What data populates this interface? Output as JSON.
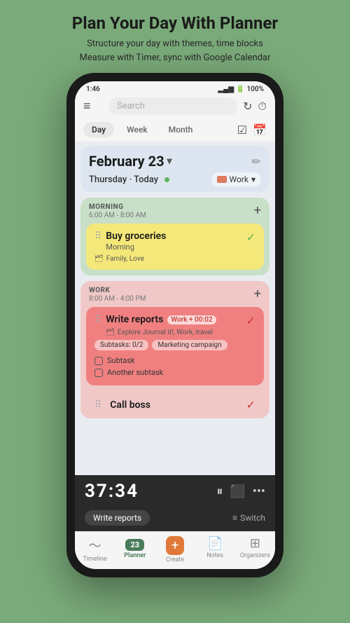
{
  "header": {
    "title": "Plan Your Day With Planner",
    "subtitle_line1": "Structure your day with themes, time blocks",
    "subtitle_line2": "Measure with Timer, sync with Google Calendar"
  },
  "status_bar": {
    "time": "1:46",
    "battery": "100%"
  },
  "search": {
    "placeholder": "Search"
  },
  "tabs": {
    "day": "Day",
    "week": "Week",
    "month": "Month"
  },
  "date": {
    "label": "February 23",
    "day": "Thursday",
    "today": "Today",
    "theme": "Work"
  },
  "morning_block": {
    "label": "MORNING",
    "time": "6:00 AM - 8:00 AM",
    "task": {
      "title": "Buy groceries",
      "subtitle": "Morning",
      "tags": "Family, Love"
    }
  },
  "work_block": {
    "label": "WORK",
    "time": "8:00 AM - 4:00 PM",
    "task1": {
      "title": "Write reports",
      "subtitle": "Work",
      "timer": "+ 00:02",
      "tags": "Explore Journal it!, Work, travel",
      "subtask_label1": "Subtasks: 0/2",
      "subtask_label2": "Marketing campaign",
      "subtask1": "Subtask",
      "subtask2": "Another subtask"
    },
    "task2": {
      "title": "Call boss"
    }
  },
  "timer": {
    "display": "37:34",
    "task_label": "Write reports"
  },
  "bottom_nav": {
    "timeline": "Timeline",
    "planner": "Planner",
    "planner_num": "23",
    "create": "Create",
    "notes": "Notes",
    "organizers": "Organizers"
  }
}
